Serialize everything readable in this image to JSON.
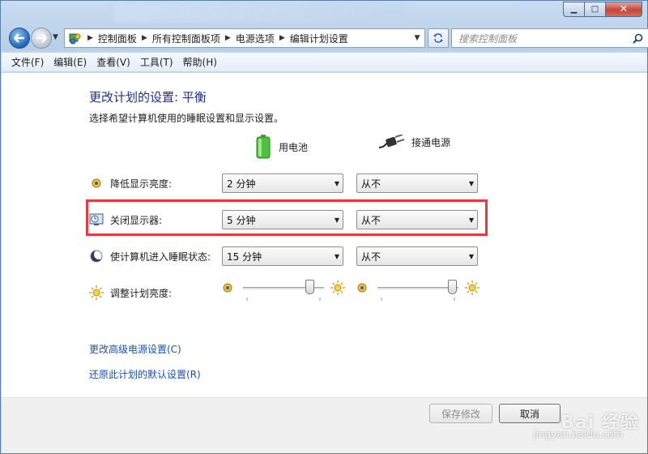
{
  "window": {
    "min_glyph": "▁",
    "max_glyph": "□",
    "close_glyph": "✕"
  },
  "address": {
    "breadcrumbs": [
      "控制面板",
      "所有控制面板项",
      "电源选项",
      "编辑计划设置"
    ],
    "search_placeholder": "搜索控制面板"
  },
  "menu": {
    "items": [
      "文件(F)",
      "编辑(E)",
      "查看(V)",
      "工具(T)",
      "帮助(H)"
    ]
  },
  "page": {
    "title": "更改计划的设置: 平衡",
    "subtitle": "选择希望计算机使用的睡眠设置和显示设置。",
    "col_battery": "用电池",
    "col_plugged": "接通电源"
  },
  "settings": [
    {
      "label": "降低显示亮度:",
      "battery": "2 分钟",
      "plugged": "从不"
    },
    {
      "label": "关闭显示器:",
      "battery": "5 分钟",
      "plugged": "从不"
    },
    {
      "label": "使计算机进入睡眠状态:",
      "battery": "15 分钟",
      "plugged": "从不"
    }
  ],
  "brightness": {
    "label": "调整计划亮度:",
    "battery_level": 0.82,
    "plugged_level": 0.92
  },
  "links": {
    "advanced": "更改高级电源设置(C)",
    "restore": "还原此计划的默认设置(R)"
  },
  "buttons": {
    "save": "保存修改",
    "cancel": "取消"
  },
  "watermark": {
    "brand": "Bai 经验",
    "url": "jingyan.baidu.com"
  },
  "colors": {
    "link": "#1a52b2",
    "title": "#1e3287",
    "highlight": "#e53a3e"
  }
}
